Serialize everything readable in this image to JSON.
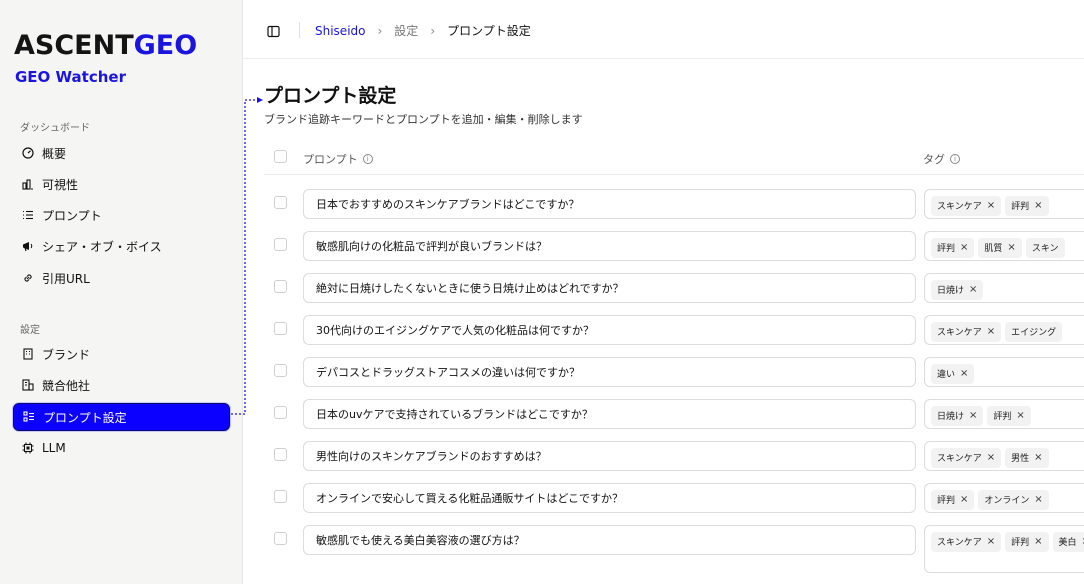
{
  "brand": {
    "logo_part1": "ASCENT",
    "logo_part2": "GEO",
    "app_name": "GEO Watcher"
  },
  "sidebar": {
    "section1_label": "ダッシュボード",
    "section1_items": [
      {
        "label": "概要",
        "icon": "gauge-icon"
      },
      {
        "label": "可視性",
        "icon": "bar-chart-icon"
      },
      {
        "label": "プロンプト",
        "icon": "list-icon"
      },
      {
        "label": "シェア・オブ・ボイス",
        "icon": "megaphone-icon"
      },
      {
        "label": "引用URL",
        "icon": "link-icon"
      }
    ],
    "section2_label": "設定",
    "section2_items": [
      {
        "label": "ブランド",
        "icon": "building-icon"
      },
      {
        "label": "競合他社",
        "icon": "buildings-icon"
      },
      {
        "label": "プロンプト設定",
        "icon": "list-settings-icon",
        "active": true
      },
      {
        "label": "LLM",
        "icon": "cpu-icon"
      }
    ]
  },
  "breadcrumb": {
    "root": "Shiseido",
    "middle": "設定",
    "current": "プロンプト設定"
  },
  "page": {
    "title": "プロンプト設定",
    "subtitle": "ブランド追跡キーワードとプロンプトを追加・編集・削除します"
  },
  "table": {
    "col_prompt": "プロンプト",
    "col_tags": "タグ",
    "rows": [
      {
        "prompt": "日本でおすすめのスキンケアブランドはどこですか？",
        "tags": [
          "スキンケア",
          "評判"
        ]
      },
      {
        "prompt": "敏感肌向けの化粧品で評判が良いブランドは？",
        "tags": [
          "評判",
          "肌質",
          "スキン"
        ]
      },
      {
        "prompt": "絶対に日焼けしたくないときに使う日焼け止めはどれですか？",
        "tags": [
          "日焼け"
        ]
      },
      {
        "prompt": "30代向けのエイジングケアで人気の化粧品は何ですか？",
        "tags": [
          "スキンケア",
          "エイジング"
        ]
      },
      {
        "prompt": "デパコスとドラッグストアコスメの違いは何ですか？",
        "tags": [
          "違い"
        ]
      },
      {
        "prompt": "日本のuvケアで支持されているブランドはどこですか？",
        "tags": [
          "日焼け",
          "評判"
        ]
      },
      {
        "prompt": "男性向けのスキンケアブランドのおすすめは？",
        "tags": [
          "スキンケア",
          "男性"
        ]
      },
      {
        "prompt": "オンラインで安心して買える化粧品通販サイトはどこですか？",
        "tags": [
          "評判",
          "オンライン"
        ]
      },
      {
        "prompt": "敏感肌でも使える美白美容液の選び方は？",
        "tags": [
          "スキンケア",
          "評判",
          "美白"
        ]
      }
    ]
  },
  "colors": {
    "accent": "#1a14e0",
    "active_bg": "#0b00ff"
  }
}
